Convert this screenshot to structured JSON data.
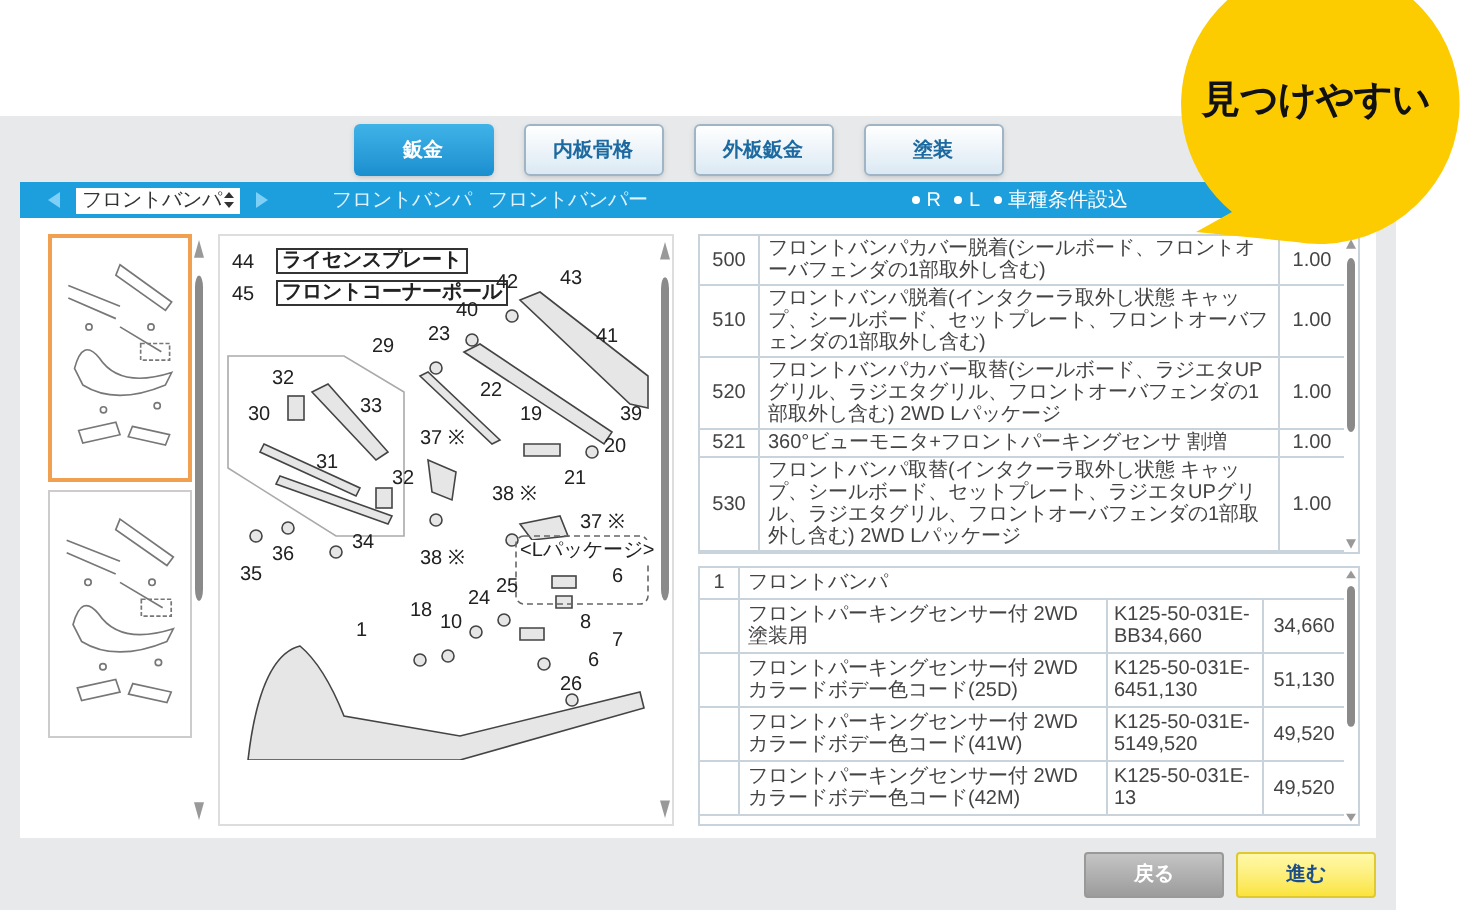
{
  "callout": {
    "text": "見つけやすい"
  },
  "tabs": [
    {
      "label": "鈑金",
      "selected": true
    },
    {
      "label": "内板骨格",
      "selected": false
    },
    {
      "label": "外板鈑金",
      "selected": false
    },
    {
      "label": "塗装",
      "selected": false
    }
  ],
  "toolbar": {
    "part_select": "フロントバンパ",
    "breadcrumb": [
      "フロントバンパ",
      "フロントバンパー"
    ],
    "legend": [
      "R",
      "L",
      "車種条件設込"
    ]
  },
  "thumbnails": [
    {
      "selected": true
    },
    {
      "selected": false
    }
  ],
  "diagram": {
    "labels": [
      {
        "text": "44",
        "kind": "number"
      },
      {
        "text": "ライセンスプレート",
        "kind": "boxed"
      },
      {
        "text": "45",
        "kind": "number"
      },
      {
        "text": "フロントコーナーポール",
        "kind": "boxed"
      },
      {
        "text": "29",
        "kind": "number"
      },
      {
        "text": "23",
        "kind": "number"
      },
      {
        "text": "40",
        "kind": "number"
      },
      {
        "text": "42",
        "kind": "number"
      },
      {
        "text": "43",
        "kind": "number"
      },
      {
        "text": "41",
        "kind": "number"
      },
      {
        "text": "22",
        "kind": "number"
      },
      {
        "text": "32",
        "kind": "number"
      },
      {
        "text": "33",
        "kind": "number"
      },
      {
        "text": "30",
        "kind": "number"
      },
      {
        "text": "31",
        "kind": "number"
      },
      {
        "text": "32",
        "kind": "number"
      },
      {
        "text": "19",
        "kind": "number"
      },
      {
        "text": "39",
        "kind": "number"
      },
      {
        "text": "20",
        "kind": "number"
      },
      {
        "text": "21",
        "kind": "number"
      },
      {
        "text": "37 ※",
        "kind": "number"
      },
      {
        "text": "38 ※",
        "kind": "number"
      },
      {
        "text": "37 ※",
        "kind": "number"
      },
      {
        "text": "36",
        "kind": "number"
      },
      {
        "text": "34",
        "kind": "number"
      },
      {
        "text": "35",
        "kind": "number"
      },
      {
        "text": "38 ※",
        "kind": "number"
      },
      {
        "text": "<Lパッケージ>",
        "kind": "package"
      },
      {
        "text": "6",
        "kind": "number"
      },
      {
        "text": "1",
        "kind": "number"
      },
      {
        "text": "18",
        "kind": "number"
      },
      {
        "text": "10",
        "kind": "number"
      },
      {
        "text": "24",
        "kind": "number"
      },
      {
        "text": "25",
        "kind": "number"
      },
      {
        "text": "8",
        "kind": "number"
      },
      {
        "text": "7",
        "kind": "number"
      },
      {
        "text": "6",
        "kind": "number"
      },
      {
        "text": "26",
        "kind": "number"
      }
    ]
  },
  "work_table": {
    "rows": [
      {
        "code": "500",
        "description": "フロントバンパカバー脱着(シールボード、フロントオーバフェンダの1部取外し含む)",
        "hours": "1.00"
      },
      {
        "code": "510",
        "description": "フロントバンパ脱着(インタクーラ取外し状態 キャップ、シールボード、セットプレート、フロントオーバフェンダの1部取外し含む)",
        "hours": "1.00"
      },
      {
        "code": "520",
        "description": "フロントバンパカバー取替(シールボード、ラジエタUPグリル、ラジエタグリル、フロントオーバフェンダの1部取外し含む) 2WD Lパッケージ",
        "hours": "1.00"
      },
      {
        "code": "521",
        "description": "360°ビューモニタ+フロントパーキングセンサ 割増",
        "hours": "1.00"
      },
      {
        "code": "530",
        "description": "フロントバンパ取替(インタクーラ取外し状態 キャップ、シールボード、セットプレート、ラジエタUPグリル、ラジエタグリル、フロントオーバフェンダの1部取外し含む) 2WD Lパッケージ",
        "hours": "1.00"
      }
    ]
  },
  "parts_table": {
    "group": {
      "no": "1",
      "name": "フロントバンパ"
    },
    "rows": [
      {
        "name": "フロントパーキングセンサー付 2WD 塗装用",
        "part_number": "K125-50-031E-BB34,660",
        "price": "34,660"
      },
      {
        "name": "フロントパーキングセンサー付 2WD カラードボデー色コード(25D)",
        "part_number": "K125-50-031E-6451,130",
        "price": "51,130"
      },
      {
        "name": "フロントパーキングセンサー付 2WD カラードボデー色コード(41W)",
        "part_number": "K125-50-031E-5149,520",
        "price": "49,520"
      },
      {
        "name": "フロントパーキングセンサー付 2WD カラードボデー色コード(42M)",
        "part_number": "K125-50-031E-13",
        "price": "49,520"
      }
    ]
  },
  "buttons": [
    {
      "label": "戻る",
      "kind": "back"
    },
    {
      "label": "進む",
      "kind": "next"
    }
  ]
}
